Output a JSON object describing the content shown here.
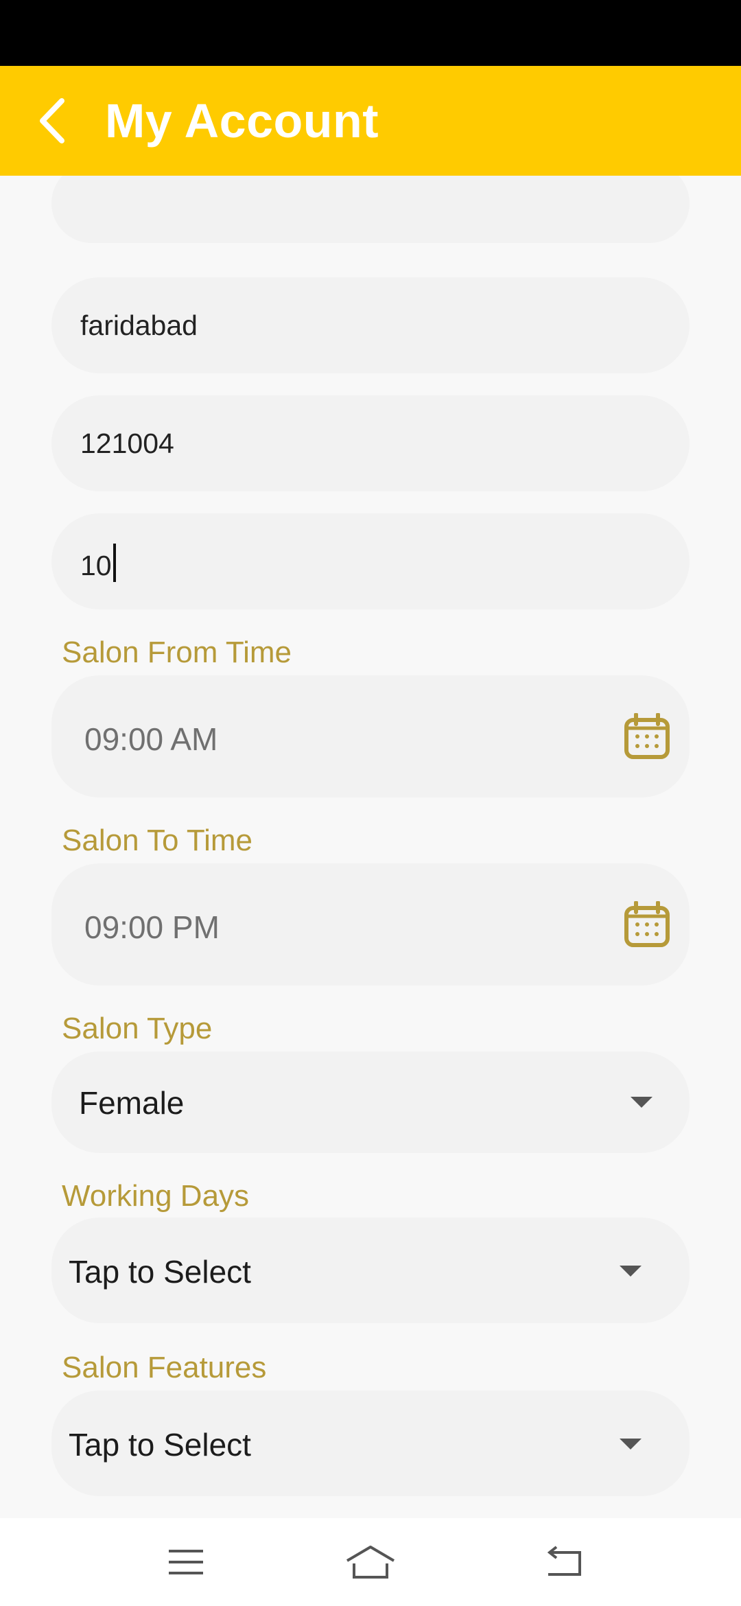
{
  "app_bar": {
    "title": "My Account",
    "background_color": "#ffcb00",
    "back_icon": "chevron-left-icon"
  },
  "form": {
    "city_value": "faridabad",
    "pincode_value": "121004",
    "third_value": "10",
    "salon_from_time": {
      "label": "Salon From Time",
      "value": "09:00 AM",
      "icon": "calendar-icon"
    },
    "salon_to_time": {
      "label": "Salon To Time",
      "value": "09:00 PM",
      "icon": "calendar-icon"
    },
    "salon_type": {
      "label": "Salon Type",
      "value": "Female",
      "icon": "dropdown-caret-icon"
    },
    "working_days": {
      "label": "Working Days",
      "value": "Tap to Select",
      "icon": "dropdown-caret-icon"
    },
    "salon_features": {
      "label": "Salon Features",
      "value": "Tap to Select",
      "icon": "dropdown-caret-icon"
    },
    "label_color": "#b69a39"
  },
  "nav_bar": {
    "menu_icon": "menu-icon",
    "home_icon": "home-icon",
    "back_icon": "back-icon"
  }
}
